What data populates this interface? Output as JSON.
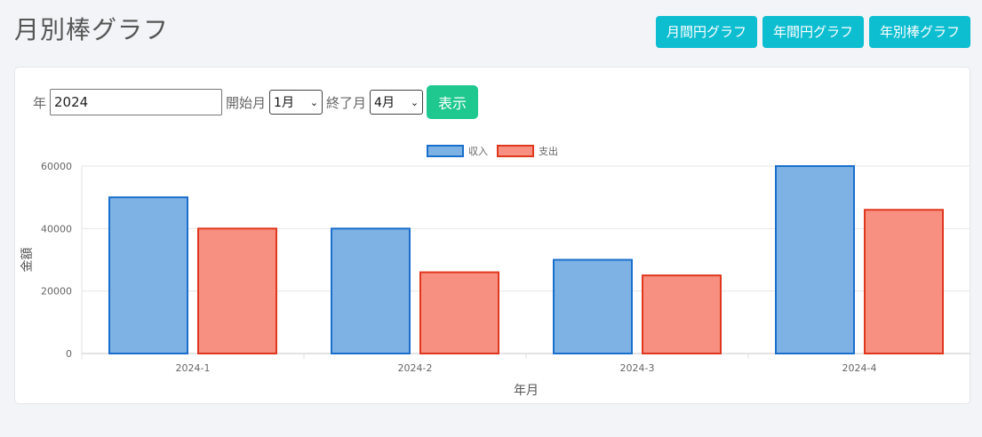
{
  "header": {
    "title": "月別棒グラフ",
    "nav": [
      "月間円グラフ",
      "年間円グラフ",
      "年別棒グラフ"
    ]
  },
  "form": {
    "year_label": "年",
    "year_value": "2024",
    "start_label": "開始月",
    "start_value": "1月",
    "end_label": "終了月",
    "end_value": "4月",
    "submit_label": "表示"
  },
  "colors": {
    "income_fill": "#7eb1e4",
    "income_border": "#1a6fcc",
    "expense_fill": "#f79080",
    "expense_border": "#e0381f",
    "nav_button": "#0dbed1",
    "submit_button": "#1ec88e"
  },
  "chart_data": {
    "type": "bar",
    "categories": [
      "2024-1",
      "2024-2",
      "2024-3",
      "2024-4"
    ],
    "series": [
      {
        "name": "収入",
        "values": [
          50000,
          40000,
          30000,
          60000
        ]
      },
      {
        "name": "支出",
        "values": [
          40000,
          26000,
          25000,
          46000
        ]
      }
    ],
    "xlabel": "年月",
    "ylabel": "金額",
    "ylim": [
      0,
      60000
    ],
    "yticks": [
      "0",
      "20000",
      "40000",
      "60000"
    ],
    "grid": true,
    "legend": "top-center"
  }
}
